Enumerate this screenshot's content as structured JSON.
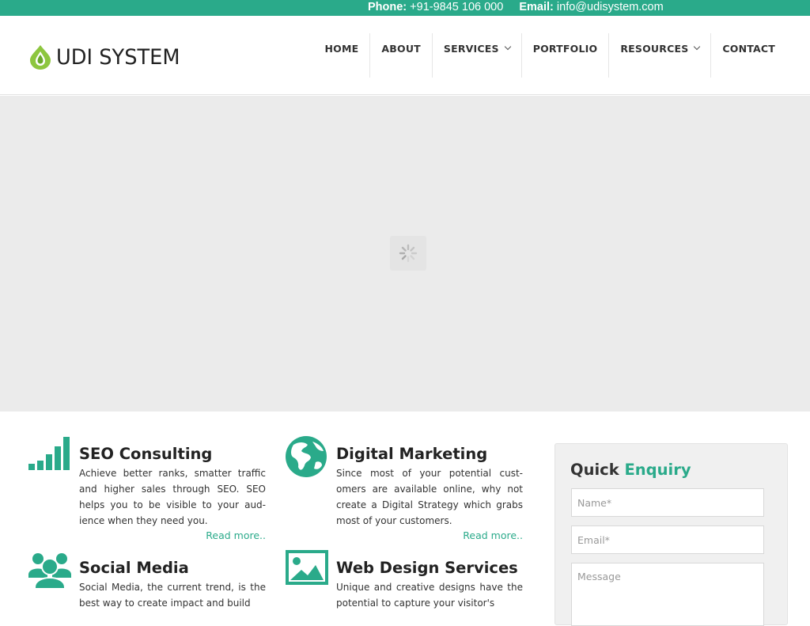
{
  "topbar": {
    "phone_label": "Phone:",
    "phone_value": "+91-9845 106 000",
    "email_label": "Email:",
    "email_value": "info@udisystem.com"
  },
  "brand": {
    "name": "UDI SYSTEM",
    "accent_color": "#2aaa8a",
    "logo_color": "#8dc63f"
  },
  "nav": {
    "items": [
      {
        "label": "HOME"
      },
      {
        "label": "ABOUT"
      },
      {
        "label": "SERVICES"
      },
      {
        "label": "PORTFOLIO"
      },
      {
        "label": "RESOURCES"
      },
      {
        "label": "CONTACT"
      }
    ]
  },
  "services": [
    {
      "title": "SEO Consulting",
      "icon": "signal-bars-icon",
      "text": "Achieve better ranks, smatter traffic and higher sales through SEO. SEO helps you to be visible to your aud-ience when they need you.",
      "link": "Read more.."
    },
    {
      "title": "Digital Marketing",
      "icon": "globe-icon",
      "text": "Since most of your potential cust-omers are available online, why not create a Digital Strategy which grabs most of your customers.",
      "link": "Read more.."
    },
    {
      "title": "Social Media",
      "icon": "users-icon",
      "text": "Social Media, the current trend, is the best way to create impact and build"
    },
    {
      "title": "Web Design Services",
      "icon": "image-icon",
      "text": "Unique and creative designs have the potential to capture your visitor's"
    }
  ],
  "enquiry": {
    "title_a": "Quick",
    "title_b": "Enquiry",
    "name_placeholder": "Name*",
    "email_placeholder": "Email*",
    "message_placeholder": "Message"
  }
}
